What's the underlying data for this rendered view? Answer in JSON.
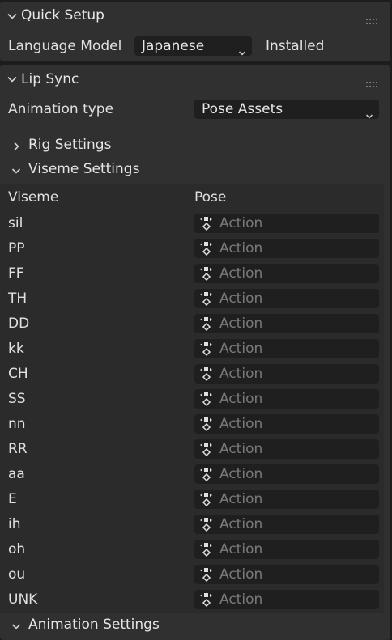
{
  "quick_setup": {
    "title": "Quick Setup",
    "language_model_label": "Language Model",
    "language_model_value": "Japanese",
    "status": "Installed"
  },
  "lip_sync": {
    "title": "Lip Sync",
    "animation_type_label": "Animation type",
    "animation_type_value": "Pose Assets",
    "rig_settings_title": "Rig Settings",
    "viseme_settings_title": "Viseme Settings",
    "viseme_col_header": "Viseme",
    "pose_col_header": "Pose",
    "action_placeholder": "Action",
    "visemes": [
      "sil",
      "PP",
      "FF",
      "TH",
      "DD",
      "kk",
      "CH",
      "SS",
      "nn",
      "RR",
      "aa",
      "E",
      "ih",
      "oh",
      "ou",
      "UNK"
    ],
    "animation_settings_title": "Animation Settings"
  },
  "icons": {
    "expand": "chevron-down-icon",
    "collapse": "chevron-right-icon",
    "drag": "grip-dots-icon",
    "dropdown": "dropdown-arrow-icon",
    "action": "action-icon"
  },
  "colors": {
    "panel_bg": "#303030",
    "field_bg": "#1f1f1f",
    "text": "#e6e6e6",
    "placeholder": "#7a7a7a"
  }
}
